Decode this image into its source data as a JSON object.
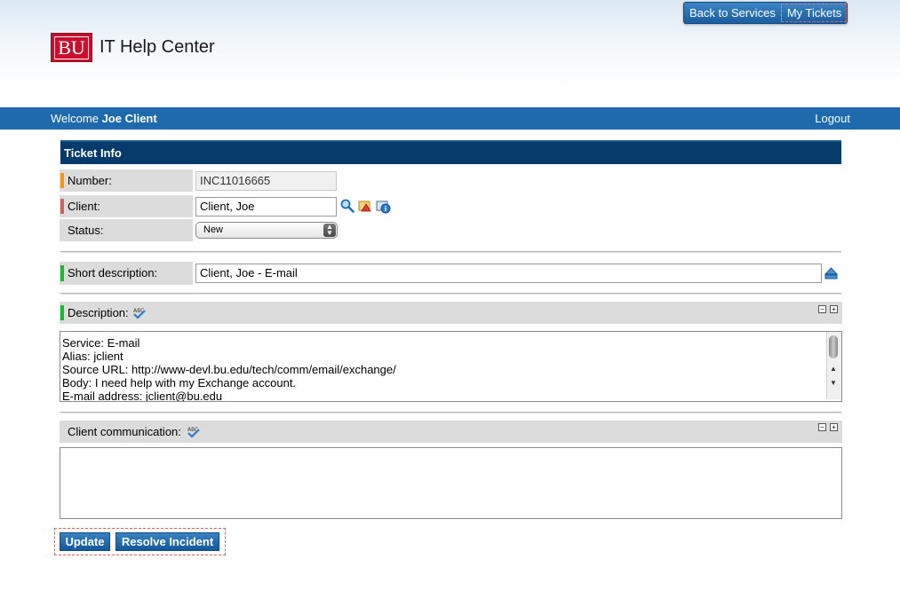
{
  "header": {
    "logo_text": "BU",
    "brand": "IT Help Center",
    "links": [
      "Back to Services",
      "My Tickets"
    ]
  },
  "welcome": {
    "prefix": "Welcome",
    "user": "Joe Client",
    "logout": "Logout"
  },
  "ticket": {
    "title": "Ticket Info",
    "number_label": "Number:",
    "number_value": "INC11016665",
    "client_label": "Client:",
    "client_value": "Client, Joe",
    "status_label": "Status:",
    "status_value": "New",
    "short_desc_label": "Short description:",
    "short_desc_value": "Client, Joe - E-mail",
    "desc_label": "Description:",
    "desc_lines": [
      "Service:  E-mail",
      "Alias: jclient",
      "Source URL: http://www-devl.bu.edu/tech/comm/email/exchange/",
      "Body: I need help with my Exchange account.",
      "E-mail address: jclient@bu.edu"
    ],
    "comm_label": "Client communication:",
    "comm_value": ""
  },
  "buttons": {
    "update": "Update",
    "resolve": "Resolve Incident"
  },
  "colors": {
    "primary_blue": "#1e6aad",
    "dark_navy": "#063a6b",
    "bar_orange": "#f0951e",
    "bar_red": "#c86464",
    "bar_green": "#22b33a"
  }
}
